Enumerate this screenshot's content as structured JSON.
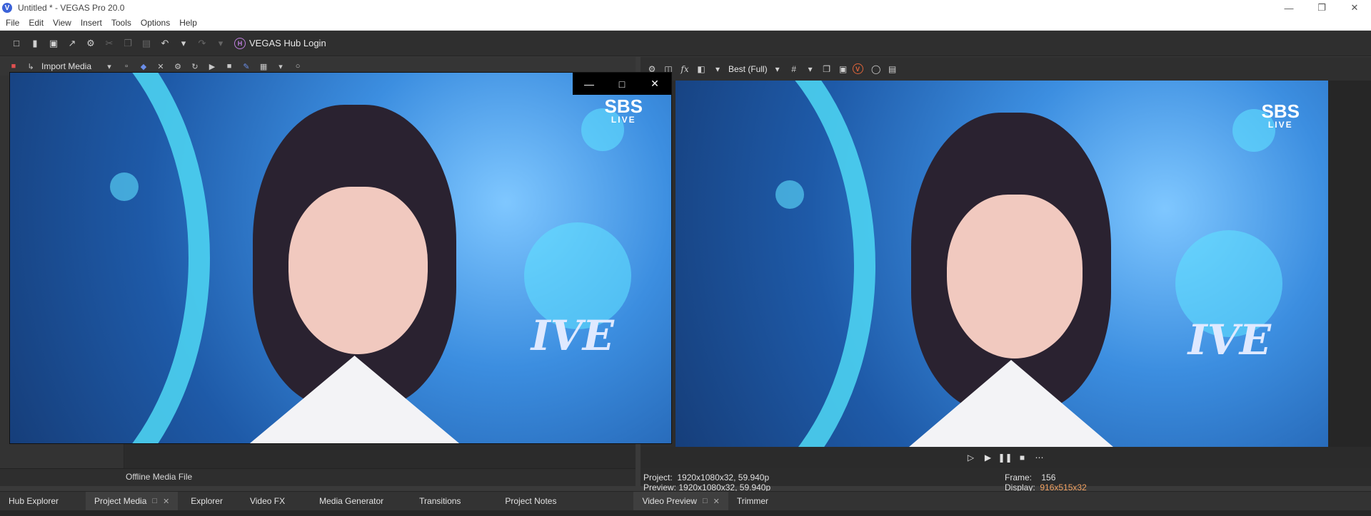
{
  "window": {
    "title": "Untitled * - VEGAS Pro 20.0",
    "app_logo": "V"
  },
  "menu": [
    "File",
    "Edit",
    "View",
    "Insert",
    "Tools",
    "Options",
    "Help"
  ],
  "toolbar": {
    "hub_login": "VEGAS Hub Login",
    "hub_badge": "H"
  },
  "left_toolbar": {
    "import_media": "Import Media"
  },
  "media_list": {
    "offline_label": "Offline Media File"
  },
  "preview_toolbar": {
    "quality": "Best (Full)",
    "vegas_badge": "V"
  },
  "preview_info": {
    "project_label": "Project:",
    "project_value": "1920x1080x32, 59.940p",
    "preview_label": "Preview:",
    "preview_value": "1920x1080x32, 59.940p",
    "frame_label": "Frame:",
    "frame_value": "156",
    "display_label": "Display:",
    "display_value": "916x515x32"
  },
  "video_overlay": {
    "sbs_top": "SBS",
    "sbs_bottom": "LIVE",
    "brand": "IVE"
  },
  "bottom_tabs": [
    {
      "label": "Hub Explorer",
      "active": false
    },
    {
      "label": "Project Media",
      "active": true
    },
    {
      "label": "Explorer",
      "active": false
    },
    {
      "label": "Video FX",
      "active": false
    },
    {
      "label": "Media Generator",
      "active": false
    },
    {
      "label": "Transitions",
      "active": false
    },
    {
      "label": "Project Notes",
      "active": false
    },
    {
      "label": "Video Preview",
      "active": true
    },
    {
      "label": "Trimmer",
      "active": false
    }
  ]
}
